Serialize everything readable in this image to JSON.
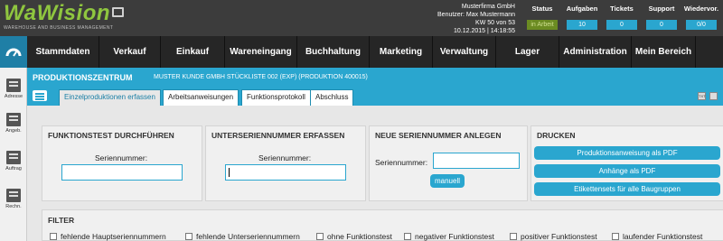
{
  "logo": {
    "text": "WaWision",
    "subtitle": "WAREHOUSE AND BUSINESS MANAGEMENT"
  },
  "user": {
    "company": "Musterfirma GmbH",
    "user_line": "Benutzer: Max Mustermann",
    "week": "KW 50 von 53",
    "datetime": "10.12.2015 | 14:18:55"
  },
  "stats": [
    {
      "label": "Status",
      "value": "in Arbeit"
    },
    {
      "label": "Aufgaben",
      "value": "10"
    },
    {
      "label": "Tickets",
      "value": "0"
    },
    {
      "label": "Support",
      "value": "0"
    },
    {
      "label": "Wiedervor.",
      "value": "0/0"
    }
  ],
  "nav": [
    "Stammdaten",
    "Verkauf",
    "Einkauf",
    "Wareneingang",
    "Buchhaltung",
    "Marketing",
    "Verwaltung",
    "Lager",
    "Administration",
    "Mein Bereich"
  ],
  "sidebar": [
    "Adresse",
    "Angeb.",
    "Auftrag",
    "Rechn."
  ],
  "page": {
    "title": "PRODUKTIONSZENTRUM",
    "subtitle": "MUSTER KUNDE GMBH STÜCKLISTE 002 (EXP) (PRODUKTION 400015)"
  },
  "tabs": [
    "Einzelproduktionen erfassen",
    "Arbeitsanweisungen",
    "Funktionsprotokoll",
    "Abschluss"
  ],
  "toolbar_icons": [
    "txt-icon",
    "print-icon"
  ],
  "panels": {
    "funktionstest": {
      "title": "FUNKTIONSTEST DURCHFÜHREN",
      "label": "Seriennummer:"
    },
    "unterserien": {
      "title": "UNTERSERIENNUMMER ERFASSEN",
      "label": "Seriennummer:"
    },
    "neue": {
      "title": "NEUE SERIENNUMMER ANLEGEN",
      "label": "Seriennummer:",
      "button": "manuell"
    },
    "drucken": {
      "title": "DRUCKEN",
      "buttons": [
        "Produktionsanweisung als PDF",
        "Anhänge als PDF",
        "Etikettensets für alle Baugruppen"
      ]
    }
  },
  "filter": {
    "title": "FILTER",
    "items": [
      "fehlende Hauptseriennummern",
      "fehlende Unterseriennummern",
      "ohne Funktionstest",
      "negativer Funktionstest",
      "positiver Funktionstest",
      "laufender Funktionstest"
    ]
  },
  "colors": {
    "accent": "#2aa6cf",
    "logo_green": "#8fc63f",
    "header": "#3c3c3c",
    "nav": "#262626"
  }
}
